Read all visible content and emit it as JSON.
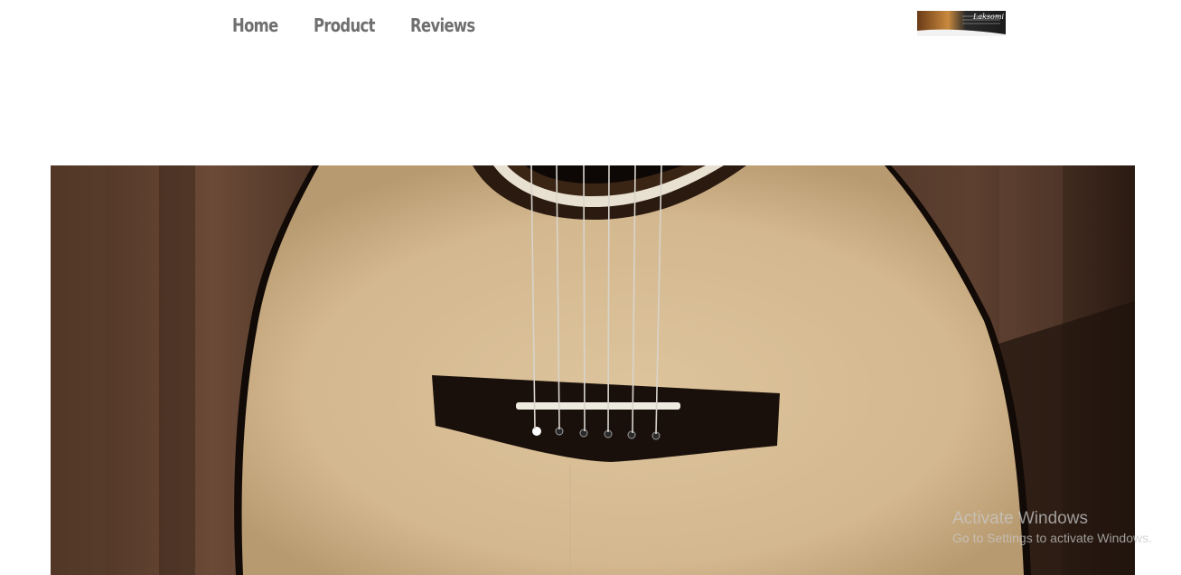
{
  "nav": {
    "items": [
      {
        "label": "Home"
      },
      {
        "label": "Product"
      },
      {
        "label": "Reviews"
      }
    ],
    "color": "#6f6f6f"
  },
  "logo": {
    "text": "Laksomi"
  },
  "hero": {
    "media": "acoustic-guitar-body-video"
  },
  "watermark": {
    "title": "Activate Windows",
    "subtitle": "Go to Settings to activate Windows."
  }
}
